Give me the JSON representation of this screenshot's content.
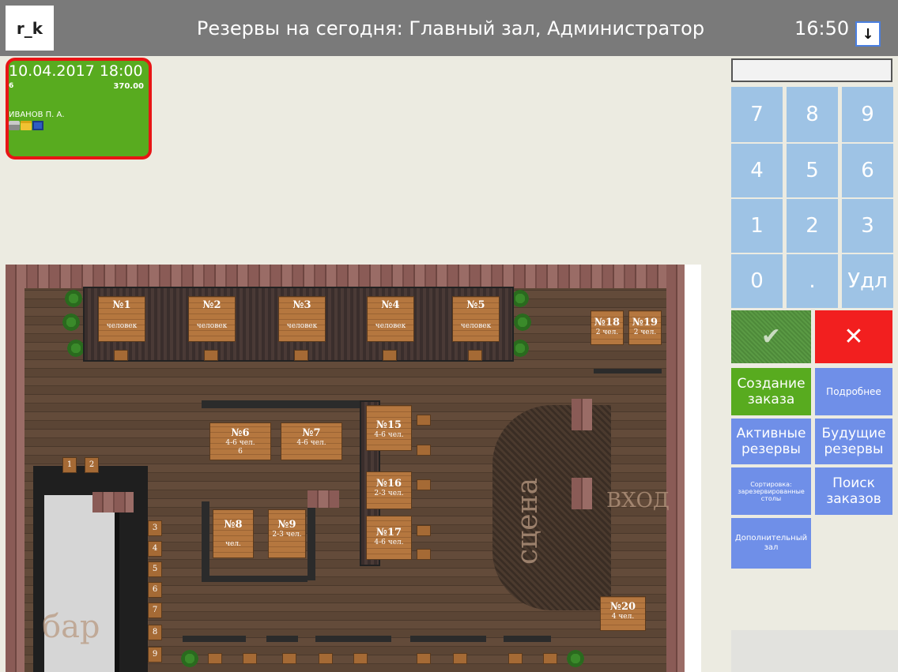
{
  "header": {
    "logo": "r_k",
    "title": "Резервы на сегодня: Главный зал, Администратор",
    "time": "16:50",
    "scroll_icon": "arrow-down-icon"
  },
  "reservation": {
    "datetime": "10.04.2017 18:00",
    "guests": "6",
    "amount": "370.00",
    "guest_name": "ИВАНОВ П. А.",
    "icons": [
      "printer-icon",
      "folder-icon",
      "save-icon"
    ]
  },
  "floor_plan": {
    "tables": [
      {
        "num": "№1",
        "cap": "человек"
      },
      {
        "num": "№2",
        "cap": "человек"
      },
      {
        "num": "№3",
        "cap": "человек"
      },
      {
        "num": "№4",
        "cap": "человек"
      },
      {
        "num": "№5",
        "cap": "человек"
      },
      {
        "num": "№6",
        "cap": "4-6 чел.",
        "extra": "6"
      },
      {
        "num": "№7",
        "cap": "4-6 чел."
      },
      {
        "num": "№8",
        "cap": "чел."
      },
      {
        "num": "№9",
        "cap": "2-3 чел."
      },
      {
        "num": "№15",
        "cap": "4-6 чел."
      },
      {
        "num": "№16",
        "cap": "2-3 чел."
      },
      {
        "num": "№17",
        "cap": "4-6 чел."
      },
      {
        "num": "№18",
        "cap": "2 чел."
      },
      {
        "num": "№19",
        "cap": "2 чел."
      },
      {
        "num": "№20",
        "cap": "4 чел."
      }
    ],
    "bar_seats": [
      "1",
      "2",
      "3",
      "4",
      "5",
      "6",
      "7",
      "8",
      "9"
    ],
    "label_stage": "сцена",
    "label_entrance": "ВХОД",
    "label_bar": "бар"
  },
  "keypad": {
    "keys": [
      "7",
      "8",
      "9",
      "4",
      "5",
      "6",
      "1",
      "2",
      "3",
      "0",
      ".",
      "Удл"
    ],
    "ok_icon": "checkmark-icon",
    "cancel_icon": "close-icon"
  },
  "actions": {
    "create_order": "Создание заказа",
    "details": "Подробнее",
    "active_reserves": "Активные резервы",
    "future_reserves": "Будущие резервы",
    "sort": "Сортировка: зарезервированные столы",
    "search_orders": "Поиск заказов",
    "extra_hall": "Дополнительный зал"
  },
  "colors": {
    "topbar": "#7a7a7a",
    "reservation_card": "#58ab1f",
    "selection_border": "#e81515",
    "keypad": "#9ec3e5",
    "action_blue": "#6f8fe8",
    "cancel": "#f21f1f"
  }
}
